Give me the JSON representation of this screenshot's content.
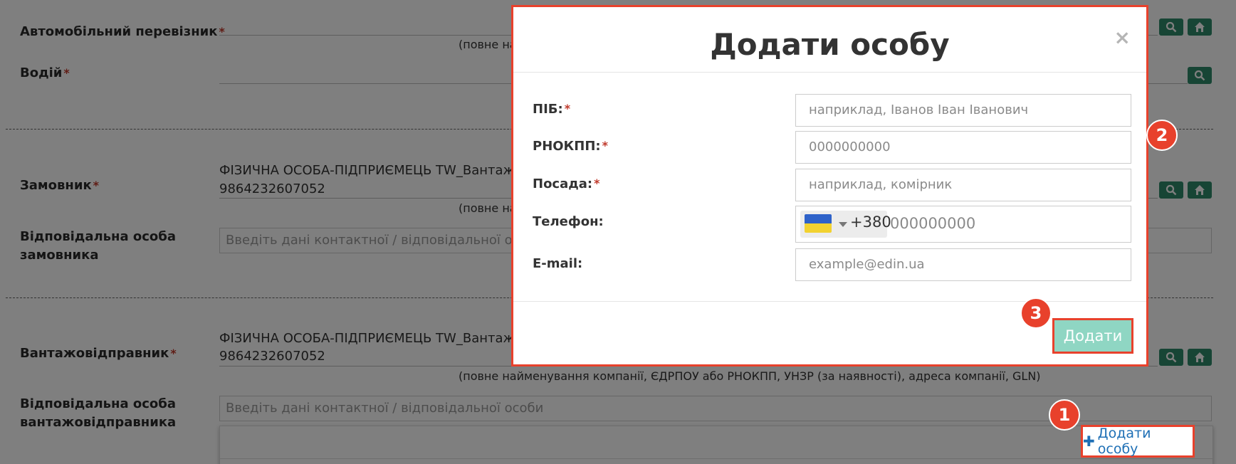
{
  "form": {
    "carrier_label": "Автомобільний перевізник",
    "carrier_helper": "(повне на",
    "driver_label": "Водій",
    "customer_label": "Замовник",
    "customer_name": "ФІЗИЧНА ОСОБА-ПІДПРИЄМЕЦЬ TW_Вантажов",
    "customer_code": "9864232607052",
    "customer_helper": "(повне на",
    "customer_contact_label_1": "Відповідальна особа",
    "customer_contact_label_2": "замовника",
    "customer_contact_placeholder": "Введіть дані контактної / відповідальної особи",
    "shipper_label": "Вантажовідправник",
    "shipper_name": "ФІЗИЧНА ОСОБА-ПІДПРИЄМЕЦЬ TW_Вантажов",
    "shipper_code": "9864232607052",
    "shipper_helper": "(повне найменування компанії, ЄДРПОУ або РНОКПП, УНЗР (за наявності), адреса компанії, GLN)",
    "shipper_contact_label_1": "Відповідальна особа",
    "shipper_contact_label_2": "вантажовідправника",
    "shipper_contact_placeholder": "Введіть дані контактної / відповідальної особи",
    "add_person_link": "Додати особу",
    "required_mark": "*"
  },
  "modal": {
    "title": "Додати особу",
    "close_glyph": "×",
    "fields": {
      "full_name_label": "ПІБ:",
      "full_name_placeholder": "наприклад, Іванов Іван Іванович",
      "tax_id_label": "РНОКПП:",
      "tax_id_placeholder": "0000000000",
      "position_label": "Посада:",
      "position_placeholder": "наприклад, комірник",
      "phone_label": "Телефон:",
      "phone_dial_code": "+380",
      "phone_placeholder": "000000000",
      "email_label": "E-mail:",
      "email_placeholder": "example@edin.ua"
    },
    "submit_label": "Додати"
  },
  "steps": [
    "1",
    "2",
    "3"
  ],
  "colors": {
    "accent_red": "#e8412c",
    "icon_button_green": "#2e8a6a",
    "submit_mint": "#8fd6c3",
    "link_blue": "#1e6fb5"
  },
  "icons": [
    "search-icon",
    "home-icon",
    "plus-icon",
    "close-icon",
    "ukraine-flag-icon",
    "caret-down-icon"
  ]
}
